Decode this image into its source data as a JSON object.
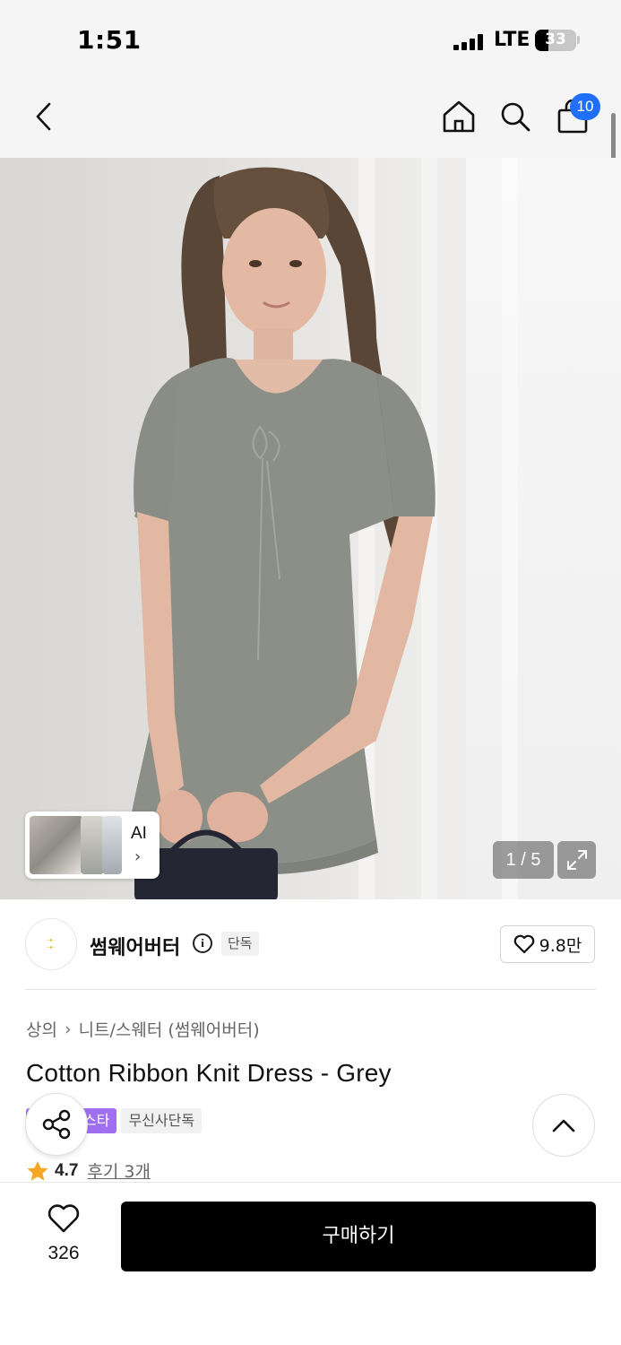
{
  "status_bar": {
    "time": "1:51",
    "network": "LTE",
    "battery": "33",
    "battery_level": 0.33
  },
  "nav": {
    "back_icon": "chevron-left-icon",
    "home_icon": "home-icon",
    "search_icon": "search-icon",
    "cart_icon": "shopping-bag-icon",
    "cart_count": "10"
  },
  "gallery": {
    "ai_label": "AI",
    "pager": "1 / 5",
    "expand_icon": "expand-icon"
  },
  "brand": {
    "name": "썸웨어버터",
    "tag": "단독",
    "like_count": "9.8만"
  },
  "product": {
    "breadcrumb": [
      "상의",
      "니트/스웨터 (썸웨어버터)"
    ],
    "title": "Cotton Ribbon Knit Dress - Grey",
    "badges": [
      "스타",
      "무신사단독"
    ],
    "rating": "4.7",
    "reviews": "후기 3개"
  },
  "bottom": {
    "wish_count": "326",
    "buy_label": "구매하기"
  },
  "colors": {
    "accent_blue": "#1f6ffb",
    "badge_purple": "#a06ef0",
    "star": "#f5a623",
    "buy_button": "#000000"
  }
}
